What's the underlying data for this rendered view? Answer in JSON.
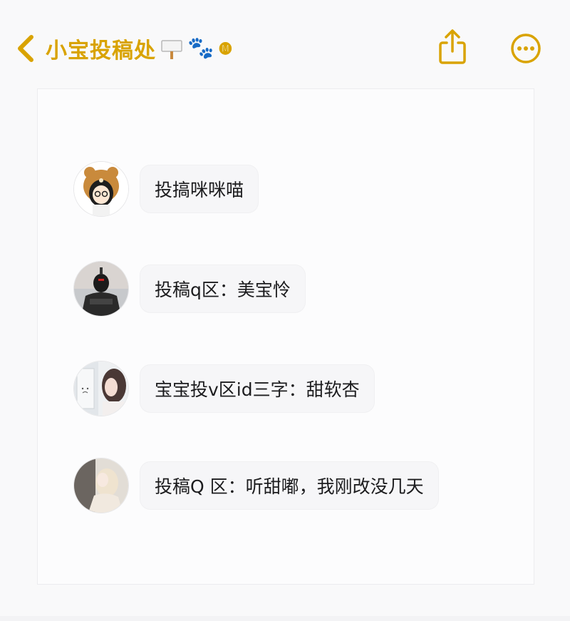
{
  "header": {
    "title": "小宝投稿处",
    "title_emoji_2": "🐾",
    "title_tail": "🅜",
    "accent_color": "#d9a300",
    "icons": [
      "chevron-left-icon",
      "signpost-icon",
      "paw-prints-icon",
      "share-icon",
      "more-icon"
    ]
  },
  "messages": [
    {
      "text": "投搞咪咪喵",
      "avatar": "bear-hat-girl-avatar"
    },
    {
      "text": "投稿q区：美宝怜",
      "avatar": "armored-figure-avatar"
    },
    {
      "text": "宝宝投v区id三字：甜软杏",
      "avatar": "girl-at-window-avatar"
    },
    {
      "text": "投稿Q 区：听甜嘟，我刚改没几天",
      "avatar": "blonde-girl-avatar"
    }
  ]
}
